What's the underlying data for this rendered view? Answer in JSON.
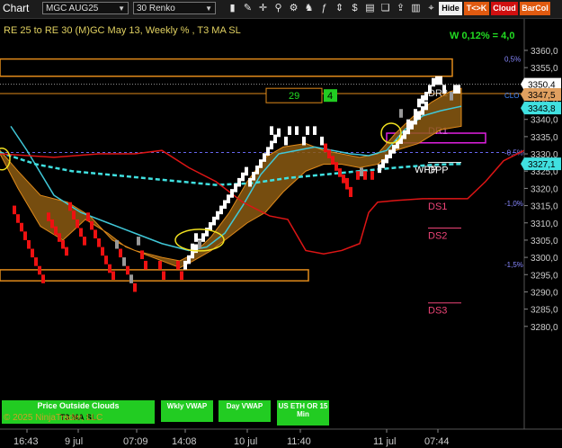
{
  "toolbar": {
    "title": "Chart",
    "instrument": "MGC AUG25",
    "bar_type": "30 Renko",
    "hide_label": "Hide",
    "tck_label": "T<>K",
    "cloud_label": "Cloud",
    "barcol_label": "BarCol",
    "icons": [
      "bar-chart-icon",
      "pencil-icon",
      "crosshair-icon",
      "zoom-icon",
      "properties-icon",
      "strategy-icon",
      "indicator-icon",
      "scale-icon",
      "trade-icon",
      "data-box-icon",
      "template-icon",
      "share-icon",
      "chart-style-icon",
      "pin-icon"
    ]
  },
  "chart": {
    "header_text": "RE 25 to RE 30 (M)GC May 13, Weekly % , T3 MA SL",
    "weekly_text": "W 0,12% = 4,0",
    "watermark": "© 2025 NinjaTrader, LLC",
    "colors": {
      "background": "#000000",
      "up_brick": "#ffffff",
      "down_brick": "#ff0000",
      "cloud": "#8b5a12",
      "cloud_edge": "#e08a1a",
      "fast_ma": "#40c8d8",
      "slow_ma_dashed": "#40e0e0",
      "red_line": "#dd1515",
      "level_box": "#e08a1a",
      "r1_box": "#e020e0",
      "vwap_button": "#22cc22"
    },
    "price_axis": {
      "ticks": [
        "3360,0",
        "3355,0",
        "3350,0",
        "3345,0",
        "3340,0",
        "3335,0",
        "3330,0",
        "3325,0",
        "3320,0",
        "3315,0",
        "3310,0",
        "3305,0",
        "3300,0",
        "3295,0",
        "3290,0",
        "3285,0",
        "3280,0"
      ],
      "label_current": "3350,4",
      "label_orange": "3347,5",
      "label_cyan": "3343,8",
      "label_cyan2": "3327,1"
    },
    "time_axis": [
      "16:43",
      "9 jul",
      "07:09",
      "14:08",
      "10 jul",
      "11:40",
      "11 jul",
      "07:44"
    ],
    "pct_labels": [
      "0,5%",
      "-0,5%",
      "-1,0%",
      "-1,5%"
    ],
    "levels": [
      "DR2",
      "DR1",
      "DPP",
      "WPP",
      "DS1",
      "DS2",
      "DS3",
      "CLO"
    ],
    "counter": {
      "value": "29",
      "badge": "4"
    },
    "buttons": {
      "price_outside": "Price Outside Clouds",
      "t3": "T3 MA SL",
      "wkly_vwap": "Wkly VWAP",
      "day_vwap": "Day VWAP",
      "us_eth": "US ETH OR 15 Min"
    }
  }
}
